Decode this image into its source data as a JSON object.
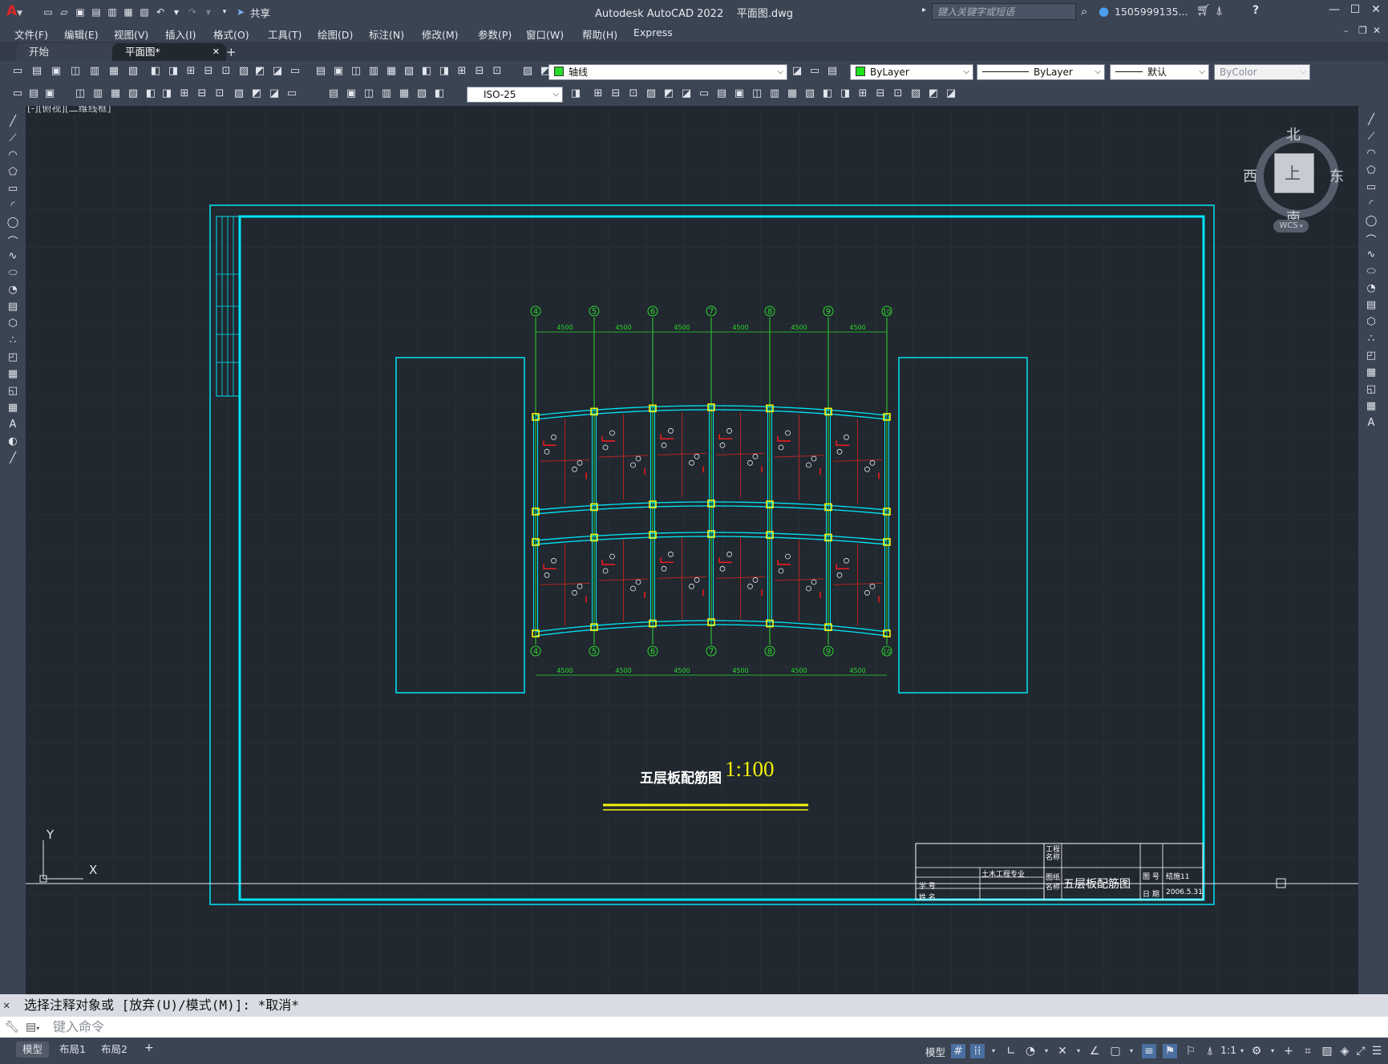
{
  "app": {
    "title": "Autodesk AutoCAD 2022",
    "filename": "平面图.dwg",
    "share_label": "共享",
    "search_placeholder": "键入关键字或短语",
    "user": "1505999135...",
    "help": "?"
  },
  "menus": [
    "文件(F)",
    "编辑(E)",
    "视图(V)",
    "插入(I)",
    "格式(O)",
    "工具(T)",
    "绘图(D)",
    "标注(N)",
    "修改(M)",
    "参数(P)",
    "窗口(W)",
    "帮助(H)",
    "Express"
  ],
  "tabs": [
    {
      "label": "开始",
      "active": false
    },
    {
      "label": "平面图*",
      "active": true
    }
  ],
  "layer_combo": "轴线",
  "color_combo": "ByLayer",
  "linetype_combo": "ByLayer",
  "lineweight_combo": "默认",
  "plotstyle_combo": "ByColor",
  "dimstyle_combo": "ISO-25",
  "viewport_label": "[-][俯视][二维线框]",
  "viewcube": {
    "north": "北",
    "south": "南",
    "east": "东",
    "west": "西",
    "top": "上",
    "wcs": "WCS"
  },
  "drawing": {
    "axes": [
      "4",
      "5",
      "6",
      "7",
      "8",
      "9",
      "10"
    ],
    "spans": [
      "4500",
      "4500",
      "4500",
      "4500",
      "4500",
      "4500"
    ],
    "title": "五层板配筋图",
    "scale": "1:100",
    "titleblock": {
      "project": "工程名称",
      "major": "土木工程专业",
      "drawing_name_label": "图纸名称",
      "drawing_name": "五层板配筋图",
      "drawing_no_label": "图 号",
      "drawing_no": "结施11",
      "date_label": "日 期",
      "date": "2006.5.31",
      "student_label": "学 号",
      "name_label": "姓 名"
    },
    "axis_y": "Y",
    "axis_x": "X"
  },
  "command": {
    "history": "选择注释对象或 [放弃(U)/模式(M)]: *取消*",
    "prompt": "键入命令"
  },
  "layout_tabs": [
    "模型",
    "布局1",
    "布局2"
  ],
  "status": {
    "model": "模型",
    "scale": "1:1"
  },
  "colors": {
    "bg": "#212830",
    "ui": "#3b4453",
    "cyan": "#00e5f5",
    "green": "#2bd92b",
    "yellow": "#f4f40a",
    "red": "#ff1a1a"
  }
}
